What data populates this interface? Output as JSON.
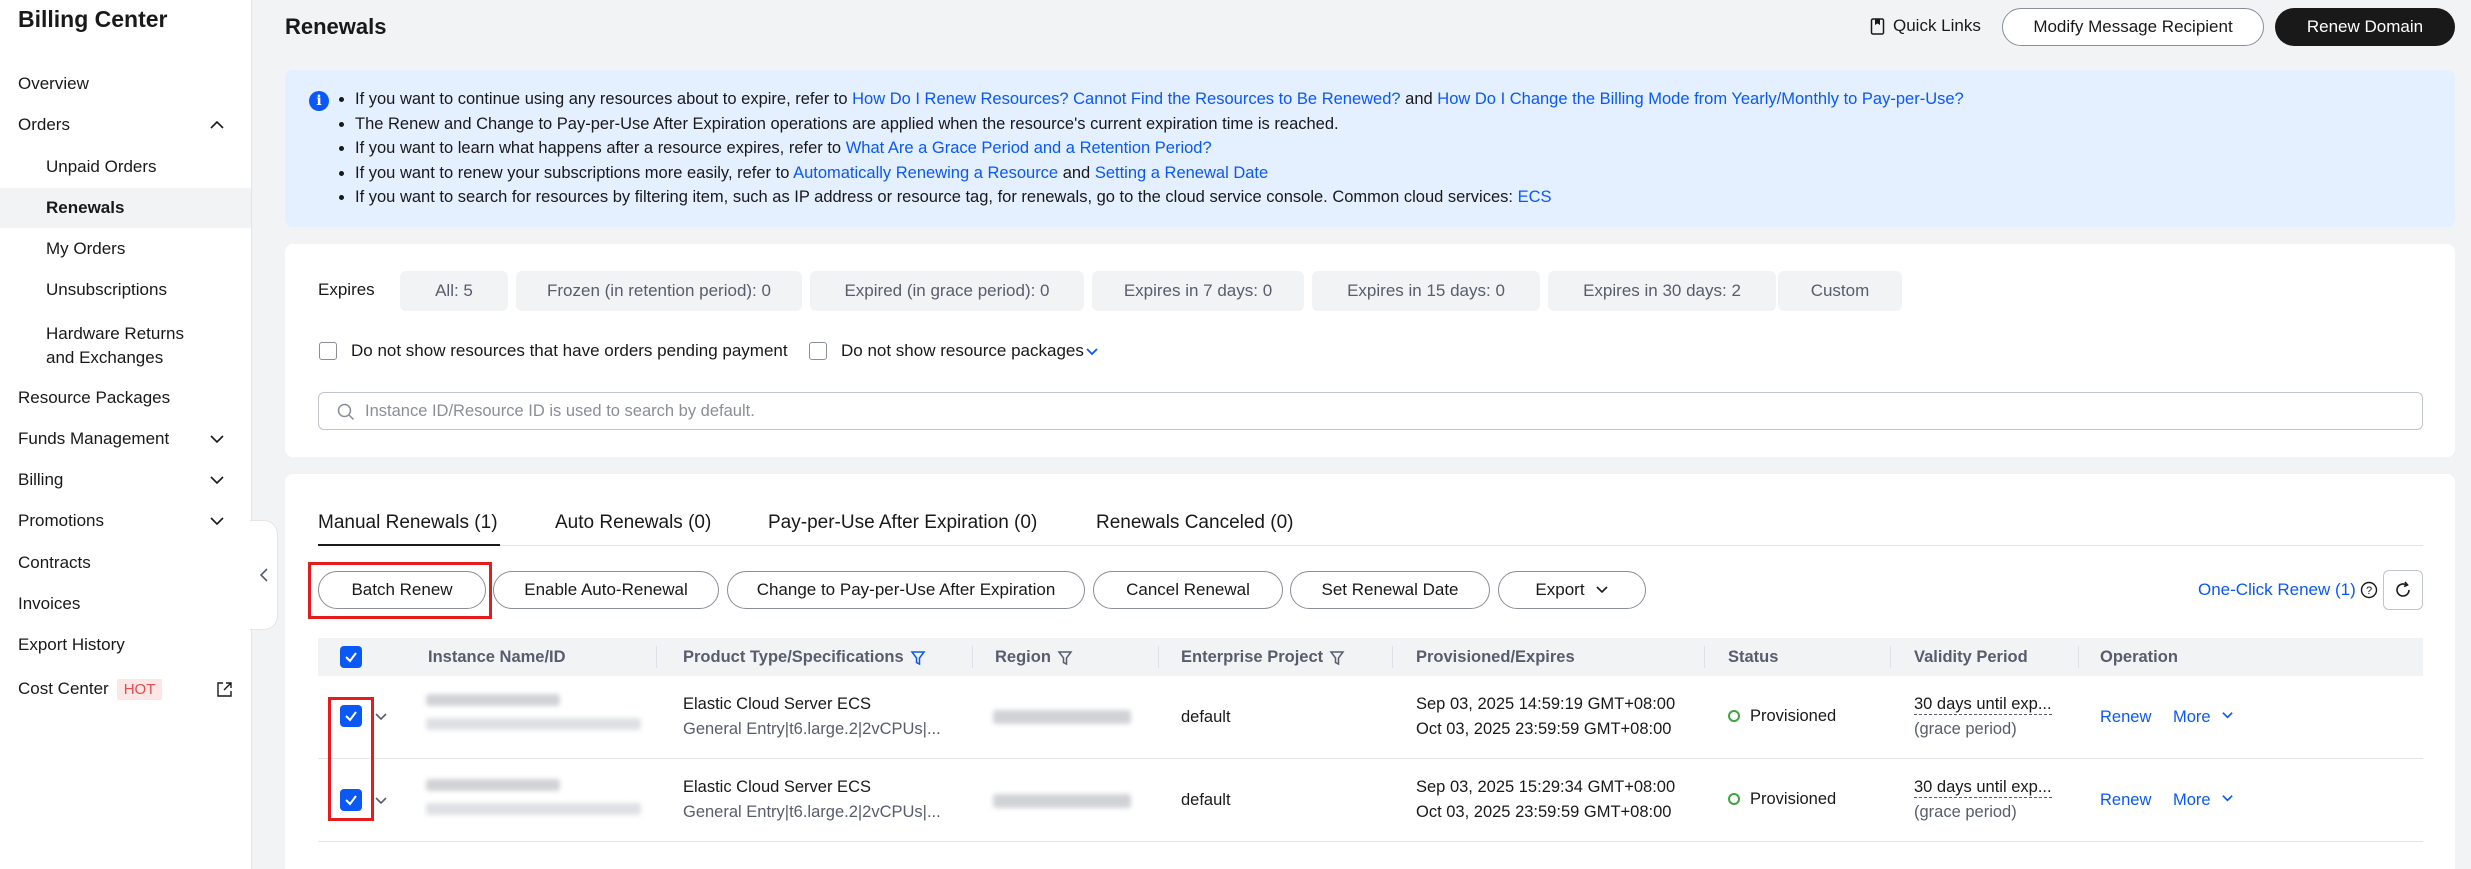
{
  "sidebar": {
    "title": "Billing Center",
    "items": {
      "overview": "Overview",
      "orders": "Orders",
      "unpaid_orders": "Unpaid Orders",
      "renewals": "Renewals",
      "my_orders": "My Orders",
      "unsubscriptions": "Unsubscriptions",
      "hardware_returns_line1": "Hardware Returns",
      "hardware_returns_line2": "and Exchanges",
      "resource_packages": "Resource Packages",
      "funds_management": "Funds Management",
      "billing": "Billing",
      "promotions": "Promotions",
      "contracts": "Contracts",
      "invoices": "Invoices",
      "export_history": "Export History",
      "cost_center": "Cost Center",
      "hot_badge": "HOT"
    }
  },
  "header": {
    "title": "Renewals",
    "quick_links": "Quick Links",
    "modify_recipient": "Modify Message Recipient",
    "renew_domain": "Renew Domain"
  },
  "info": {
    "line1_prefix": "If you want to continue using any resources about to expire, refer to ",
    "line1_link1": "How Do I Renew Resources? Cannot Find the Resources to Be Renewed?",
    "line1_and": " and ",
    "line1_link2": "How Do I Change the Billing Mode from Yearly/Monthly to Pay-per-Use?",
    "line2": "The Renew and Change to Pay-per-Use After Expiration operations are applied when the resource's current expiration time is reached.",
    "line3_prefix": "If you want to learn what happens after a resource expires, refer to ",
    "line3_link": "What Are a Grace Period and a Retention Period?",
    "line4_prefix": "If you want to renew your subscriptions more easily, refer to ",
    "line4_link1": "Automatically Renewing a Resource",
    "line4_and": " and ",
    "line4_link2": "Setting a Renewal Date",
    "line5_prefix": "If you want to search for resources by filtering item, such as IP address or resource tag, for renewals, go to the cloud service console. Common cloud services: ",
    "line5_link": "ECS"
  },
  "filters": {
    "expires_label": "Expires",
    "chips": [
      "All: 5",
      "Frozen (in retention period): 0",
      "Expired (in grace period): 0",
      "Expires in 7 days: 0",
      "Expires in 15 days: 0",
      "Expires in 30 days: 2",
      "Custom"
    ],
    "pending_payment": "Do not show resources that have orders pending payment",
    "resource_packages": "Do not show resource packages",
    "search_placeholder": "Instance ID/Resource ID is used to search by default."
  },
  "tabs": [
    "Manual Renewals (1)",
    "Auto Renewals (0)",
    "Pay-per-Use After Expiration (0)",
    "Renewals Canceled (0)"
  ],
  "actions": {
    "batch_renew": "Batch Renew",
    "enable_auto_renewal": "Enable Auto-Renewal",
    "change_ppu": "Change to Pay-per-Use After Expiration",
    "cancel_renewal": "Cancel Renewal",
    "set_renewal_date": "Set Renewal Date",
    "export": "Export",
    "one_click_renew": "One-Click Renew (1)"
  },
  "table": {
    "columns": {
      "instance": "Instance Name/ID",
      "product": "Product Type/Specifications",
      "region": "Region",
      "enterprise_project": "Enterprise Project",
      "provisioned_expires": "Provisioned/Expires",
      "status": "Status",
      "validity": "Validity Period",
      "operation": "Operation"
    },
    "rows": [
      {
        "product": "Elastic Cloud Server ECS",
        "spec": "General Entry|t6.large.2|2vCPUs|...",
        "enterprise_project": "default",
        "provisioned": "Sep 03, 2025 14:59:19 GMT+08:00",
        "expires": "Oct 03, 2025 23:59:59 GMT+08:00",
        "status": "Provisioned",
        "validity": "30 days until exp...",
        "validity_note": "(grace period)",
        "renew": "Renew",
        "more": "More"
      },
      {
        "product": "Elastic Cloud Server ECS",
        "spec": "General Entry|t6.large.2|2vCPUs|...",
        "enterprise_project": "default",
        "provisioned": "Sep 03, 2025 15:29:34 GMT+08:00",
        "expires": "Oct 03, 2025 23:59:59 GMT+08:00",
        "status": "Provisioned",
        "validity": "30 days until exp...",
        "validity_note": "(grace period)",
        "renew": "Renew",
        "more": "More"
      }
    ]
  },
  "colors": {
    "accent": "#0a59f7",
    "dark_button": "#191919",
    "highlight_box": "#e51c1c",
    "status_ok": "#3fa33f",
    "info_bg": "#e4efff"
  }
}
